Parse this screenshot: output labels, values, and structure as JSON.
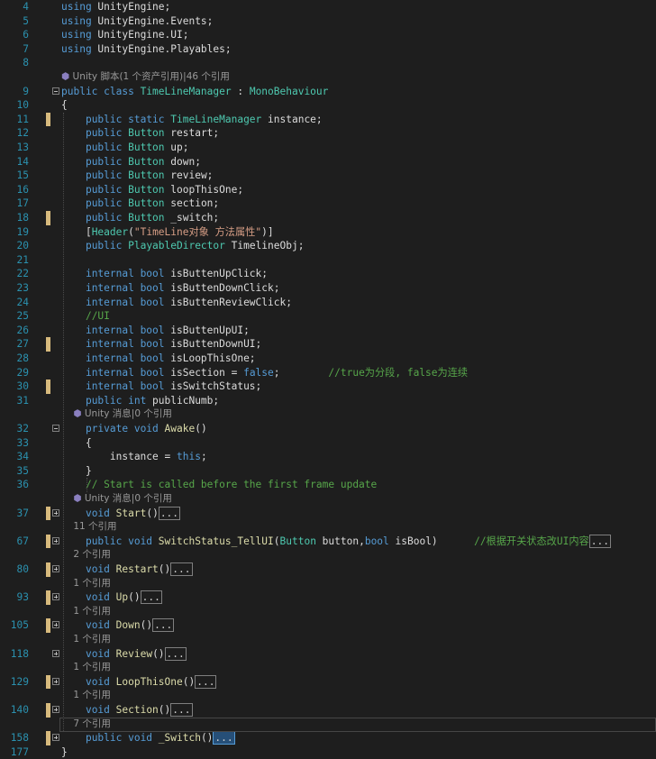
{
  "editor": {
    "lines": [
      {
        "n": "4",
        "tokens": [
          [
            "kw",
            "using "
          ],
          [
            "id",
            "UnityEngine;"
          ]
        ]
      },
      {
        "n": "5",
        "tokens": [
          [
            "kw",
            "using "
          ],
          [
            "id",
            "UnityEngine.Events;"
          ]
        ]
      },
      {
        "n": "6",
        "tokens": [
          [
            "kw",
            "using "
          ],
          [
            "id",
            "UnityEngine.UI;"
          ]
        ]
      },
      {
        "n": "7",
        "tokens": [
          [
            "kw",
            "using "
          ],
          [
            "id",
            "UnityEngine.Playables;"
          ]
        ]
      },
      {
        "n": "8",
        "tokens": []
      },
      {
        "lens": "Unity 脚本(1 个资产引用)|46 个引用",
        "icon": true
      },
      {
        "n": "9",
        "fold": "open",
        "tokens": [
          [
            "kw",
            "public class "
          ],
          [
            "ty",
            "TimeLineManager"
          ],
          [
            "id",
            " : "
          ],
          [
            "ty",
            "MonoBehaviour"
          ]
        ]
      },
      {
        "n": "10",
        "tokens": [
          [
            "id",
            "{"
          ]
        ]
      },
      {
        "n": "11",
        "mark": "saved",
        "tokens": [
          [
            "id",
            "    "
          ],
          [
            "kw",
            "public static "
          ],
          [
            "ty",
            "TimeLineManager"
          ],
          [
            "id",
            " instance;"
          ]
        ]
      },
      {
        "n": "12",
        "tokens": [
          [
            "id",
            "    "
          ],
          [
            "kw",
            "public "
          ],
          [
            "ty",
            "Button"
          ],
          [
            "id",
            " restart;"
          ]
        ]
      },
      {
        "n": "13",
        "tokens": [
          [
            "id",
            "    "
          ],
          [
            "kw",
            "public "
          ],
          [
            "ty",
            "Button"
          ],
          [
            "id",
            " up;"
          ]
        ]
      },
      {
        "n": "14",
        "tokens": [
          [
            "id",
            "    "
          ],
          [
            "kw",
            "public "
          ],
          [
            "ty",
            "Button"
          ],
          [
            "id",
            " down;"
          ]
        ]
      },
      {
        "n": "15",
        "tokens": [
          [
            "id",
            "    "
          ],
          [
            "kw",
            "public "
          ],
          [
            "ty",
            "Button"
          ],
          [
            "id",
            " review;"
          ]
        ]
      },
      {
        "n": "16",
        "tokens": [
          [
            "id",
            "    "
          ],
          [
            "kw",
            "public "
          ],
          [
            "ty",
            "Button"
          ],
          [
            "id",
            " loopThisOne;"
          ]
        ]
      },
      {
        "n": "17",
        "tokens": [
          [
            "id",
            "    "
          ],
          [
            "kw",
            "public "
          ],
          [
            "ty",
            "Button"
          ],
          [
            "id",
            " section;"
          ]
        ]
      },
      {
        "n": "18",
        "mark": "saved",
        "tokens": [
          [
            "id",
            "    "
          ],
          [
            "kw",
            "public "
          ],
          [
            "ty",
            "Button"
          ],
          [
            "id",
            " _switch;"
          ]
        ]
      },
      {
        "n": "19",
        "tokens": [
          [
            "id",
            "    ["
          ],
          [
            "ty",
            "Header"
          ],
          [
            "id",
            "("
          ],
          [
            "st",
            "\"TimeLine对象 方法属性\""
          ],
          [
            "id",
            ")]"
          ]
        ]
      },
      {
        "n": "20",
        "tokens": [
          [
            "id",
            "    "
          ],
          [
            "kw",
            "public "
          ],
          [
            "ty",
            "PlayableDirector"
          ],
          [
            "id",
            " TimelineObj;"
          ]
        ]
      },
      {
        "n": "21",
        "tokens": []
      },
      {
        "n": "22",
        "tokens": [
          [
            "id",
            "    "
          ],
          [
            "kw",
            "internal bool "
          ],
          [
            "id",
            "isButtenUpClick;"
          ]
        ]
      },
      {
        "n": "23",
        "tokens": [
          [
            "id",
            "    "
          ],
          [
            "kw",
            "internal bool "
          ],
          [
            "id",
            "isButtenDownClick;"
          ]
        ]
      },
      {
        "n": "24",
        "tokens": [
          [
            "id",
            "    "
          ],
          [
            "kw",
            "internal bool "
          ],
          [
            "id",
            "isButtenReviewClick;"
          ]
        ]
      },
      {
        "n": "25",
        "tokens": [
          [
            "id",
            "    "
          ],
          [
            "cm",
            "//UI"
          ]
        ]
      },
      {
        "n": "26",
        "tokens": [
          [
            "id",
            "    "
          ],
          [
            "kw",
            "internal bool "
          ],
          [
            "id",
            "isButtenUpUI;"
          ]
        ]
      },
      {
        "n": "27",
        "mark": "saved",
        "tokens": [
          [
            "id",
            "    "
          ],
          [
            "kw",
            "internal bool "
          ],
          [
            "id",
            "isButtenDownUI;"
          ]
        ]
      },
      {
        "n": "28",
        "tokens": [
          [
            "id",
            "    "
          ],
          [
            "kw",
            "internal bool "
          ],
          [
            "id",
            "isLoopThisOne;"
          ]
        ]
      },
      {
        "n": "29",
        "tokens": [
          [
            "id",
            "    "
          ],
          [
            "kw",
            "internal bool "
          ],
          [
            "id",
            "isSection = "
          ],
          [
            "kw",
            "false"
          ],
          [
            "id",
            ";        "
          ],
          [
            "cm",
            "//true为分段, false为连续"
          ]
        ]
      },
      {
        "n": "30",
        "mark": "saved",
        "tokens": [
          [
            "id",
            "    "
          ],
          [
            "kw",
            "internal bool "
          ],
          [
            "id",
            "isSwitchStatus;"
          ]
        ]
      },
      {
        "n": "31",
        "tokens": [
          [
            "id",
            "    "
          ],
          [
            "kw",
            "public int "
          ],
          [
            "id",
            "publicNumb;"
          ]
        ]
      },
      {
        "lens": "    Unity 消息|0 个引用",
        "icon": true
      },
      {
        "n": "32",
        "fold": "open",
        "tokens": [
          [
            "id",
            "    "
          ],
          [
            "kw",
            "private void "
          ],
          [
            "me",
            "Awake"
          ],
          [
            "id",
            "()"
          ]
        ]
      },
      {
        "n": "33",
        "tokens": [
          [
            "id",
            "    {"
          ]
        ]
      },
      {
        "n": "34",
        "tokens": [
          [
            "id",
            "        instance = "
          ],
          [
            "kw",
            "this"
          ],
          [
            "id",
            ";"
          ]
        ]
      },
      {
        "n": "35",
        "tokens": [
          [
            "id",
            "    }"
          ]
        ]
      },
      {
        "n": "36",
        "tokens": [
          [
            "id",
            "    "
          ],
          [
            "cm",
            "// Start is called before the first frame update"
          ]
        ]
      },
      {
        "lens": "    Unity 消息|0 个引用",
        "icon": true
      },
      {
        "n": "37",
        "fold": "closed",
        "mark": "saved",
        "tokens": [
          [
            "id",
            "    "
          ],
          [
            "kw",
            "void "
          ],
          [
            "me",
            "Start"
          ],
          [
            "id",
            "()"
          ],
          [
            "box",
            "..."
          ]
        ]
      },
      {
        "lens": "    11 个引用"
      },
      {
        "n": "67",
        "fold": "closed",
        "mark": "saved",
        "tokens": [
          [
            "id",
            "    "
          ],
          [
            "kw",
            "public void "
          ],
          [
            "me",
            "SwitchStatus_TellUI"
          ],
          [
            "id",
            "("
          ],
          [
            "ty",
            "Button"
          ],
          [
            "id",
            " button,"
          ],
          [
            "kw",
            "bool"
          ],
          [
            "id",
            " isBool)      "
          ],
          [
            "cm",
            "//根据开关状态改UI内容"
          ],
          [
            "box",
            "..."
          ]
        ]
      },
      {
        "lens": "    2 个引用"
      },
      {
        "n": "80",
        "fold": "closed",
        "mark": "saved",
        "tokens": [
          [
            "id",
            "    "
          ],
          [
            "kw",
            "void "
          ],
          [
            "me",
            "Restart"
          ],
          [
            "id",
            "()"
          ],
          [
            "box",
            "..."
          ]
        ]
      },
      {
        "lens": "    1 个引用"
      },
      {
        "n": "93",
        "fold": "closed",
        "mark": "saved",
        "tokens": [
          [
            "id",
            "    "
          ],
          [
            "kw",
            "void "
          ],
          [
            "me",
            "Up"
          ],
          [
            "id",
            "()"
          ],
          [
            "box",
            "..."
          ]
        ]
      },
      {
        "lens": "    1 个引用"
      },
      {
        "n": "105",
        "fold": "closed",
        "mark": "saved",
        "tokens": [
          [
            "id",
            "    "
          ],
          [
            "kw",
            "void "
          ],
          [
            "me",
            "Down"
          ],
          [
            "id",
            "()"
          ],
          [
            "box",
            "..."
          ]
        ]
      },
      {
        "lens": "    1 个引用"
      },
      {
        "n": "118",
        "fold": "closed",
        "tokens": [
          [
            "id",
            "    "
          ],
          [
            "kw",
            "void "
          ],
          [
            "me",
            "Review"
          ],
          [
            "id",
            "()"
          ],
          [
            "box",
            "..."
          ]
        ]
      },
      {
        "lens": "    1 个引用"
      },
      {
        "n": "129",
        "fold": "closed",
        "mark": "saved",
        "tokens": [
          [
            "id",
            "    "
          ],
          [
            "kw",
            "void "
          ],
          [
            "me",
            "LoopThisOne"
          ],
          [
            "id",
            "()"
          ],
          [
            "box",
            "..."
          ]
        ]
      },
      {
        "lens": "    1 个引用"
      },
      {
        "n": "140",
        "fold": "closed",
        "mark": "saved",
        "tokens": [
          [
            "id",
            "    "
          ],
          [
            "kw",
            "void "
          ],
          [
            "me",
            "Section"
          ],
          [
            "id",
            "()"
          ],
          [
            "box",
            "..."
          ]
        ]
      },
      {
        "lens": "    7 个引用"
      },
      {
        "n": "158",
        "fold": "closed",
        "mark": "saved",
        "tokens": [
          [
            "id",
            "    "
          ],
          [
            "kw",
            "public void "
          ],
          [
            "me",
            "_Switch"
          ],
          [
            "id",
            "()"
          ],
          [
            "sel",
            "..."
          ]
        ]
      },
      {
        "n": "177",
        "tokens": [
          [
            "id",
            "}"
          ]
        ]
      }
    ]
  },
  "colors": {
    "background": "#1e1e1e",
    "line_number": "#2b91af",
    "keyword": "#569cd6",
    "type": "#4ec9b0",
    "comment": "#57a64a",
    "string": "#d69d85",
    "method": "#dcdcaa",
    "saved_mark": "#d7ba7d"
  },
  "icons": {
    "unity_lens": "unity-icon",
    "fold_open": "fold-minus-icon",
    "fold_closed": "fold-plus-icon"
  }
}
